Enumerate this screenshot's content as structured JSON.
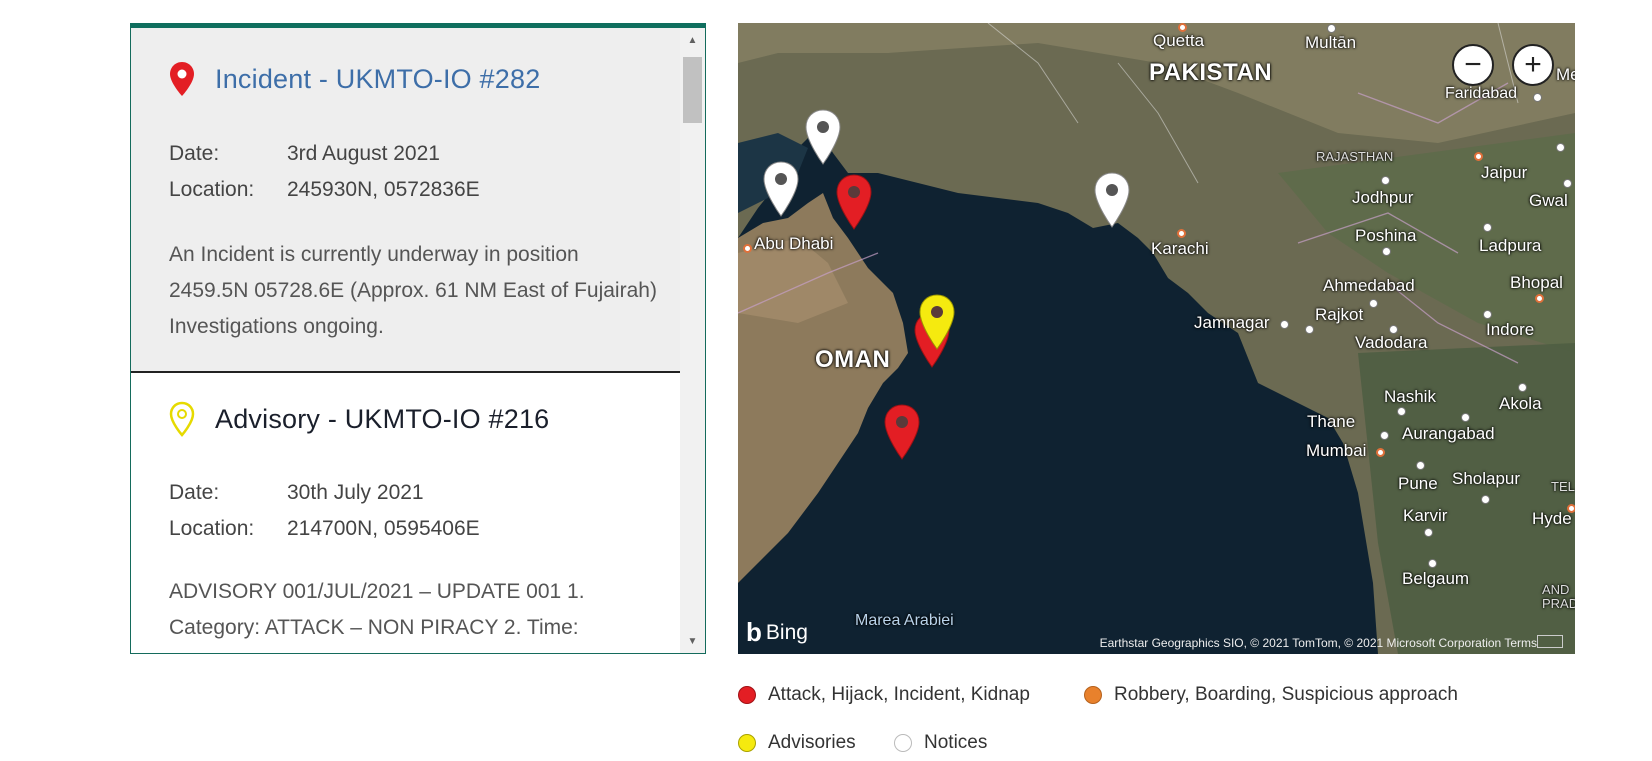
{
  "incidents": [
    {
      "title": "Incident - UKMTO-IO #282",
      "date_label": "Date:",
      "date": "3rd August 2021",
      "location_label": "Location:",
      "location": "245930N, 0572836E",
      "description": "An Incident is currently underway in position 2459.5N 05728.6E (Approx. 61 NM East of Fujairah) Investigations ongoing.",
      "marker_color": "#e31e24"
    },
    {
      "title": "Advisory - UKMTO-IO #216",
      "date_label": "Date:",
      "date": "30th July 2021",
      "location_label": "Location:",
      "location": "214700N, 0595406E",
      "description": "ADVISORY 001/JUL/2021 – UPDATE 001 1. Category: ATTACK – NON PIRACY 2. Time:",
      "marker_color": "#f5ea0f"
    }
  ],
  "map": {
    "labels": {
      "quetta": "Quetta",
      "multan": "Multān",
      "pakistan": "PAKISTAN",
      "faridabad": "Faridabad",
      "rajasthan": "RAJASTHAN",
      "jaipur": "Jaipur",
      "jodhpur": "Jodhpur",
      "gwal": "Gwal",
      "abu_dhabi": "Abu Dhabi",
      "karachi": "Karachi",
      "poshina": "Poshina",
      "ladpura": "Ladpura",
      "ahmedabad": "Ahmedabad",
      "bhopal": "Bhopal",
      "jamnagar": "Jamnagar",
      "rajkot": "Rajkot",
      "indore": "Indore",
      "vadodara": "Vadodara",
      "oman": "OMAN",
      "nashik": "Nashik",
      "akola": "Akola",
      "thane": "Thane",
      "aurangabad": "Aurangabad",
      "mumbai": "Mumbai",
      "pune": "Pune",
      "sholapur": "Sholapur",
      "karvir": "Karvir",
      "hyde": "Hyde",
      "belgaum": "Belgaum",
      "tel": "TEL",
      "and": "AND",
      "prad": "PRAD",
      "me": "Me",
      "sea": "Marea Arabiei"
    },
    "zoom_out": "−",
    "zoom_in": "+",
    "bing": "Bing",
    "copyright": "Earthstar Geographics SIO, © 2021 TomTom, © 2021 Microsoft Corporation  Terms",
    "colors": {
      "attack": "#e31e24",
      "advisory": "#f5ea0f",
      "notice": "#ffffff"
    }
  },
  "legend": [
    {
      "label": "Attack, Hijack, Incident, Kidnap",
      "color": "#e31e24"
    },
    {
      "label": "Robbery, Boarding, Suspicious approach",
      "color": "#e8812c"
    },
    {
      "label": "Advisories",
      "color": "#f5ea0f"
    },
    {
      "label": "Notices",
      "color": "#ffffff"
    }
  ]
}
